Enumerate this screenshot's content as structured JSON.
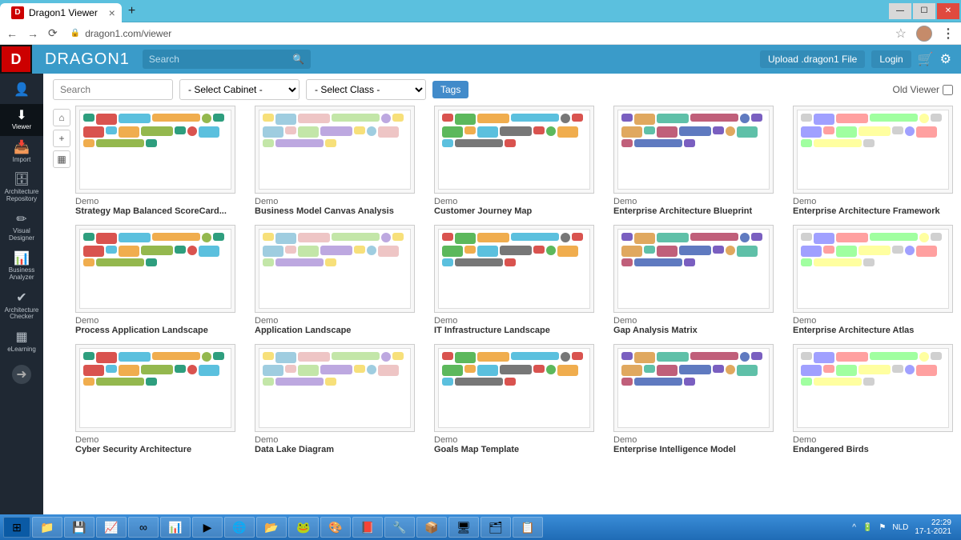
{
  "window": {
    "tab_title": "Dragon1 Viewer",
    "url": "dragon1.com/viewer"
  },
  "header": {
    "brand": "DRAGON1",
    "search_placeholder": "Search",
    "upload_btn": "Upload .dragon1 File",
    "login_btn": "Login"
  },
  "sidebar": {
    "items": [
      {
        "icon": "👤",
        "label": ""
      },
      {
        "icon": "⬇",
        "label": "Viewer"
      },
      {
        "icon": "📥",
        "label": "Import"
      },
      {
        "icon": "🗄",
        "label": "Architecture Repository"
      },
      {
        "icon": "✏",
        "label": "Visual Designer"
      },
      {
        "icon": "📊",
        "label": "Business Analyzer"
      },
      {
        "icon": "✔",
        "label": "Architecture Checker"
      },
      {
        "icon": "▦",
        "label": "eLearning"
      }
    ]
  },
  "toolbar": {
    "search_placeholder": "Search",
    "cabinet_placeholder": "- Select Cabinet -",
    "class_placeholder": "- Select Class -",
    "tags_btn": "Tags",
    "old_viewer": "Old Viewer"
  },
  "mini": {
    "home": "⌂",
    "add": "+",
    "layout": "▦"
  },
  "cards": [
    [
      {
        "category": "Demo",
        "title": "Strategy Map Balanced ScoreCard..."
      },
      {
        "category": "Demo",
        "title": "Business Model Canvas Analysis"
      },
      {
        "category": "Demo",
        "title": "Customer Journey Map"
      },
      {
        "category": "Demo",
        "title": "Enterprise Architecture Blueprint"
      },
      {
        "category": "Demo",
        "title": "Enterprise Architecture Framework"
      }
    ],
    [
      {
        "category": "Demo",
        "title": "Process Application Landscape"
      },
      {
        "category": "Demo",
        "title": "Application Landscape"
      },
      {
        "category": "Demo",
        "title": "IT Infrastructure Landscape"
      },
      {
        "category": "Demo",
        "title": "Gap Analysis Matrix"
      },
      {
        "category": "Demo",
        "title": "Enterprise Architecture Atlas"
      }
    ],
    [
      {
        "category": "Demo",
        "title": "Cyber Security Architecture"
      },
      {
        "category": "Demo",
        "title": "Data Lake Diagram"
      },
      {
        "category": "Demo",
        "title": "Goals Map Template"
      },
      {
        "category": "Demo",
        "title": "Enterprise Intelligence Model"
      },
      {
        "category": "Demo",
        "title": "Endangered Birds"
      }
    ]
  ],
  "taskbar": {
    "lang": "NLD",
    "time": "22:29",
    "date": "17-1-2021"
  }
}
